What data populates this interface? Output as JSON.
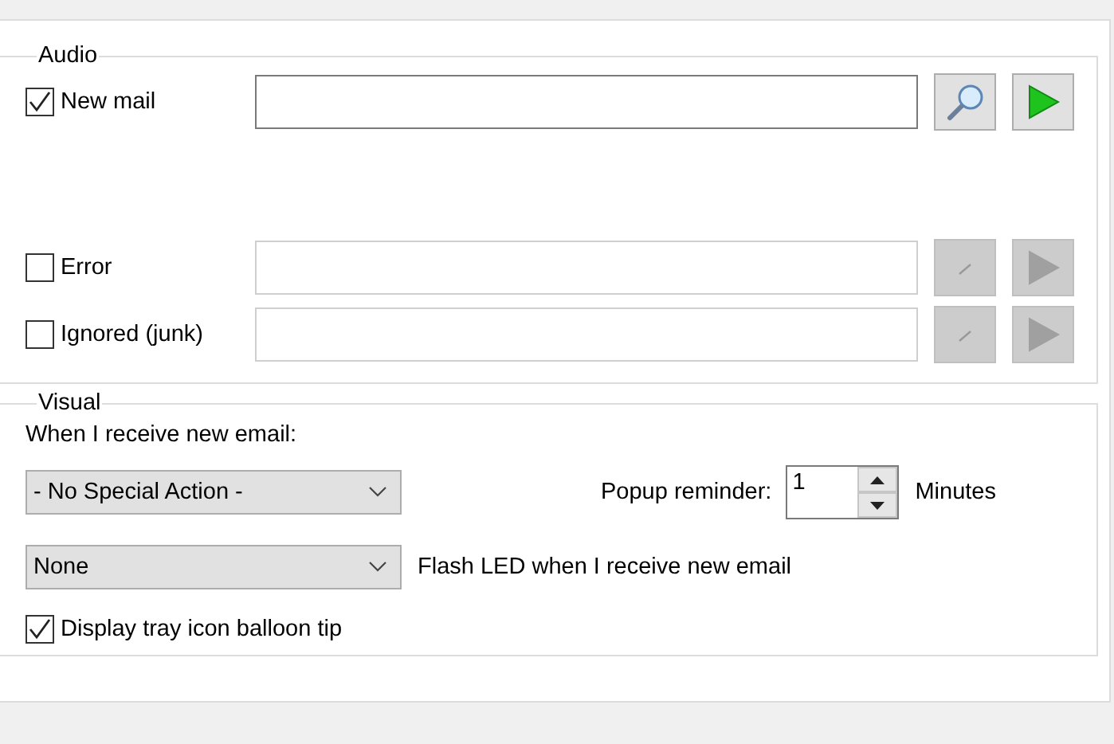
{
  "audio": {
    "title": "Audio",
    "sounds": [
      {
        "label": "New mail",
        "checked": true
      },
      {
        "label": "Error",
        "checked": false
      },
      {
        "label": "Ignored (junk)",
        "checked": false
      }
    ]
  },
  "visual": {
    "title": "Visual",
    "prompt": "When I receive new email:",
    "action_dropdown": {
      "value": "- No Special Action -"
    },
    "popup_label": "Popup reminder:",
    "popup_value": "1",
    "popup_unit": "Minutes",
    "led_dropdown": {
      "value": "None"
    },
    "led_label": "Flash LED when I receive new email",
    "balloon": {
      "label": "Display tray icon balloon tip",
      "checked": true
    }
  }
}
